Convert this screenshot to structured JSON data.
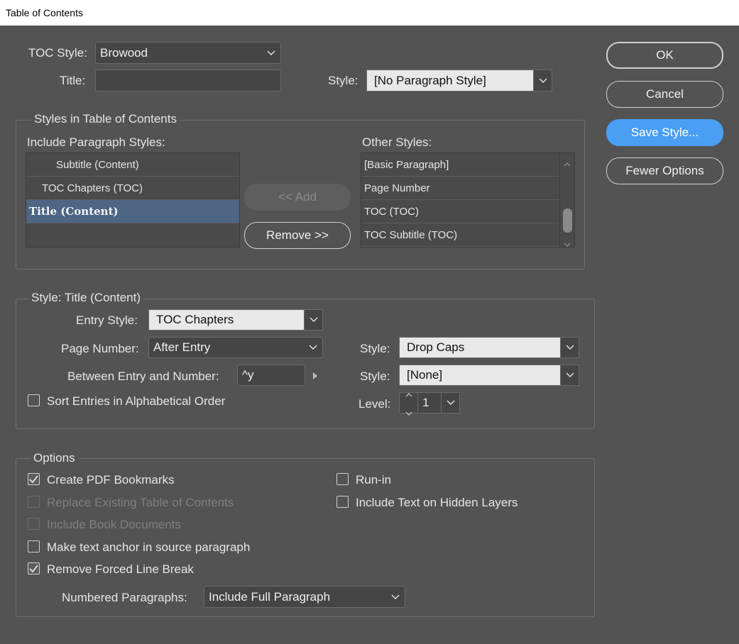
{
  "window": {
    "title": "Table of Contents"
  },
  "toc_style": {
    "label": "TOC Style:",
    "value": "Browood"
  },
  "title_field": {
    "label": "Title:",
    "value": ""
  },
  "title_style": {
    "label": "Style:",
    "value": "[No Paragraph Style]"
  },
  "buttons": {
    "ok": "OK",
    "cancel": "Cancel",
    "save_style": "Save Style...",
    "fewer_options": "Fewer Options",
    "add": "<< Add",
    "remove": "Remove >>"
  },
  "styles_group": {
    "title": "Styles in Table of Contents",
    "include_label": "Include Paragraph Styles:",
    "include_items": [
      {
        "label": "Subtitle (Content)",
        "selected": false
      },
      {
        "label": "TOC Chapters (TOC)",
        "selected": false
      },
      {
        "label": "Title (Content)",
        "selected": true
      }
    ],
    "other_label": "Other Styles:",
    "other_items": [
      "[Basic Paragraph]",
      "Page Number",
      "TOC (TOC)",
      "TOC Subtitle (TOC)"
    ]
  },
  "style_group": {
    "title": "Style: Title (Content)",
    "entry_style": {
      "label": "Entry Style:",
      "value": "TOC Chapters"
    },
    "page_number": {
      "label": "Page Number:",
      "value": "After Entry"
    },
    "page_number_style": {
      "label": "Style:",
      "value": "Drop Caps"
    },
    "between": {
      "label": "Between Entry and Number:",
      "value": "^y"
    },
    "between_style": {
      "label": "Style:",
      "value": "[None]"
    },
    "sort": {
      "label": "Sort Entries in Alphabetical Order",
      "checked": false
    },
    "level": {
      "label": "Level:",
      "value": "1"
    }
  },
  "options_group": {
    "title": "Options",
    "create_pdf": {
      "label": "Create PDF Bookmarks",
      "checked": true
    },
    "replace_existing": {
      "label": "Replace Existing Table of Contents",
      "checked": false,
      "disabled": true
    },
    "include_book": {
      "label": "Include Book Documents",
      "checked": false,
      "disabled": true
    },
    "make_anchor": {
      "label": "Make text anchor in source paragraph",
      "checked": false
    },
    "remove_forced": {
      "label": "Remove Forced Line Break",
      "checked": true
    },
    "run_in": {
      "label": "Run-in",
      "checked": false
    },
    "include_hidden": {
      "label": "Include Text on Hidden Layers",
      "checked": false
    },
    "numbered": {
      "label": "Numbered Paragraphs:",
      "value": "Include Full Paragraph"
    }
  },
  "colors": {
    "background": "#535353",
    "accent": "#4a9ff5",
    "selection": "#4e6584"
  }
}
